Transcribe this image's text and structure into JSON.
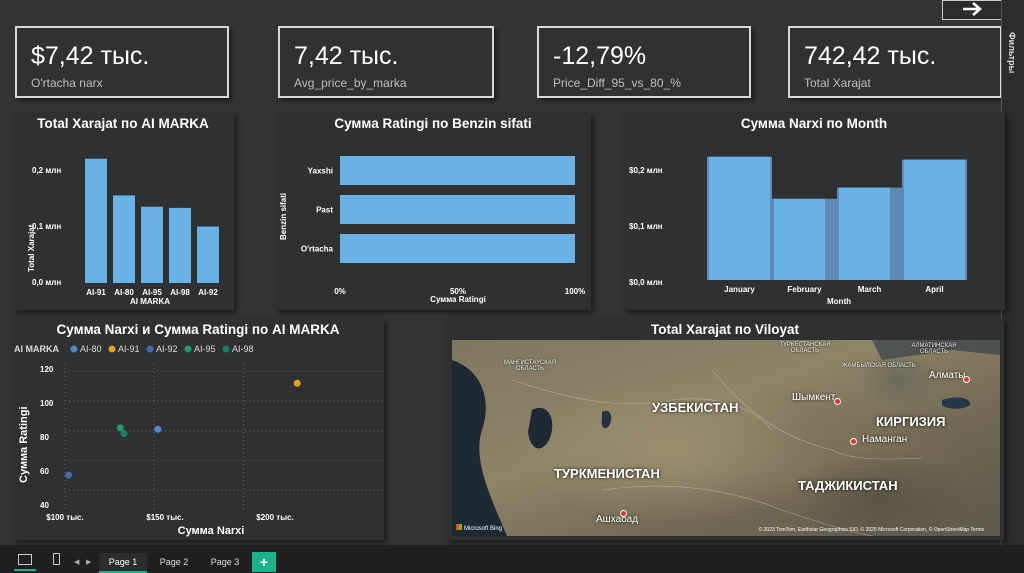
{
  "kpis": [
    {
      "value": "$7,42 тыс.",
      "label": "O'rtacha narx"
    },
    {
      "value": "7,42 тыс.",
      "label": "Avg_price_by_marka"
    },
    {
      "value": "-12,79%",
      "label": "Price_Diff_95_vs_80_%"
    },
    {
      "value": "742,42 тыс.",
      "label": "Total Xarajat"
    }
  ],
  "side_panel": {
    "label": "Фильтры"
  },
  "charts": {
    "bar": {
      "title": "Total Xarajat по AI MARKA",
      "ylabel": "Total Xarajat",
      "xlabel": "AI MARKA",
      "yticks": [
        "0,2 млн",
        "0,1 млн",
        "0,0 млн"
      ]
    },
    "hbar": {
      "title": "Сумма Ratingi по Benzin sifati",
      "ylabel": "Benzin sifati",
      "xlabel": "Сумма Ratingi",
      "xticks": [
        "0%",
        "50%",
        "100%"
      ]
    },
    "area": {
      "title": "Сумма Narxi по Month",
      "xlabel": "Month",
      "yticks": [
        "$0,2 млн",
        "$0,1 млн",
        "$0,0 млн"
      ]
    },
    "scatter": {
      "title": "Сумма Narxi и Сумма Ratingi по AI MARKA",
      "legend_title": "AI MARKA",
      "xlabel": "Сумма Narxi",
      "ylabel": "Сумма Ratingi",
      "yticks": [
        "120",
        "100",
        "80",
        "60",
        "40"
      ],
      "xticks": [
        "$100 тыс.",
        "$150 тыс.",
        "$200 тыс."
      ]
    },
    "map": {
      "title": "Total Xarajat по Viloyat",
      "labels": [
        "УЗБЕКИСТАН",
        "КИРГИЗИЯ",
        "ТУРКМЕНИСТАН",
        "ТАДЖИКИСТАН",
        "Алматы",
        "Шымкент",
        "Наманган",
        "Ашхабад",
        "ТУРКЕСТАНСКАЯ ОБЛАСТЬ",
        "АЛМАТИНСКАЯ ОБЛАСТЬ",
        "ЖАМБЫЛСКАЯ ОБЛАСТЬ",
        "МАНГИСТАУСКАЯ ОБЛАСТЬ",
        "Microsoft Bing"
      ],
      "copyright": "© 2023 TomTom, Earthstar Geographics SIO, © 2025 Microsoft Corporation, © OpenStreetMap Terms"
    }
  },
  "chart_data": [
    {
      "type": "bar",
      "title": "Total Xarajat по AI MARKA",
      "xlabel": "AI MARKA",
      "ylabel": "Total Xarajat",
      "categories": [
        "AI-91",
        "AI-80",
        "AI-95",
        "AI-98",
        "AI-92"
      ],
      "values": [
        0.22,
        0.155,
        0.135,
        0.133,
        0.1
      ],
      "unit": "млн",
      "ylim": [
        0,
        0.25
      ]
    },
    {
      "type": "bar",
      "orientation": "horizontal",
      "title": "Сумма Ratingi по Benzin sifati",
      "xlabel": "Сумма Ratingi",
      "ylabel": "Benzin sifati",
      "categories": [
        "Yaxshi",
        "Past",
        "O'rtacha"
      ],
      "values": [
        100,
        100,
        100
      ],
      "unit": "%",
      "xlim": [
        0,
        100
      ]
    },
    {
      "type": "area",
      "title": "Сумма Narxi по Month",
      "xlabel": "Month",
      "categories": [
        "January",
        "February",
        "March",
        "April"
      ],
      "values": [
        0.22,
        0.145,
        0.165,
        0.215
      ],
      "unit": "$ млн",
      "ylim": [
        0,
        0.25
      ]
    },
    {
      "type": "scatter",
      "title": "Сумма Narxi и Сумма Ratingi по AI MARKA",
      "xlabel": "Сумма Narxi",
      "ylabel": "Сумма Ratingi",
      "legend_position": "top",
      "xlim": [
        100,
        240
      ],
      "ylim": [
        40,
        125
      ],
      "series": [
        {
          "name": "AI-80",
          "color": "#4f89c9",
          "points": [
            [
              152,
              81
            ]
          ]
        },
        {
          "name": "AI-91",
          "color": "#e3a21a",
          "points": [
            [
              230,
              112
            ]
          ]
        },
        {
          "name": "AI-92",
          "color": "#3f6fa8",
          "points": [
            [
              102,
              50
            ]
          ]
        },
        {
          "name": "AI-95",
          "color": "#1f9a73",
          "points": [
            [
              131,
              82
            ]
          ]
        },
        {
          "name": "AI-98",
          "color": "#158060",
          "points": [
            [
              133,
              78
            ]
          ]
        }
      ]
    }
  ],
  "pages": {
    "tabs": [
      "Page 1",
      "Page 2",
      "Page 3"
    ],
    "add": "+"
  },
  "colors": {
    "bar": "#6ab1e5",
    "background": "#333436",
    "panel": "#2f3032"
  }
}
